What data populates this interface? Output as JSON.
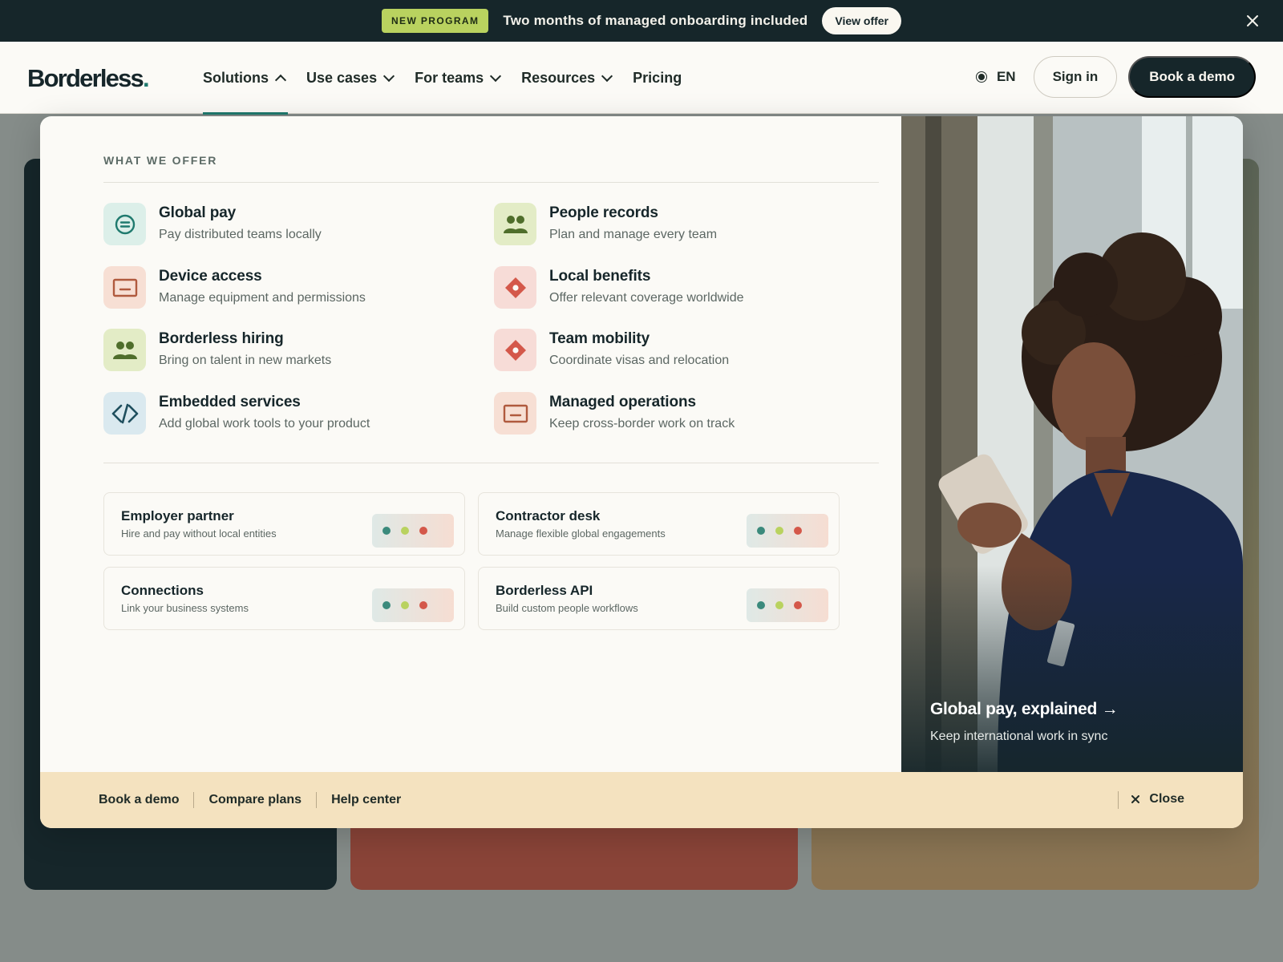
{
  "announcement": {
    "tag": "NEW PROGRAM",
    "message": "Two months of managed onboarding included",
    "cta": "View offer"
  },
  "brand": {
    "name": "Borderless",
    "suffix": "."
  },
  "nav": {
    "items": [
      {
        "label": "Solutions",
        "open": true
      },
      {
        "label": "Use cases"
      },
      {
        "label": "For teams"
      },
      {
        "label": "Resources"
      },
      {
        "label": "Pricing"
      }
    ],
    "lang": "EN",
    "signin": "Sign in",
    "book_demo": "Book a demo"
  },
  "panel": {
    "eyebrow": "WHAT WE OFFER",
    "offers": [
      {
        "title": "Global pay",
        "desc": "Pay distributed teams locally",
        "icon": "global-pay-icon"
      },
      {
        "title": "People records",
        "desc": "Plan and manage every team",
        "icon": "people-icon"
      },
      {
        "title": "Device access",
        "desc": "Manage equipment and permissions",
        "icon": "device-icon"
      },
      {
        "title": "Local benefits",
        "desc": "Offer relevant coverage worldwide",
        "icon": "diamond-icon"
      },
      {
        "title": "Borderless hiring",
        "desc": "Bring on talent in new markets",
        "icon": "people-icon"
      },
      {
        "title": "Team mobility",
        "desc": "Coordinate visas and relocation",
        "icon": "diamond-icon"
      },
      {
        "title": "Embedded services",
        "desc": "Add global work tools to your product",
        "icon": "code-icon"
      },
      {
        "title": "Managed operations",
        "desc": "Keep cross-border work on track",
        "icon": "device-icon"
      }
    ],
    "cards": [
      {
        "title": "Employer partner",
        "desc": "Hire and pay without local entities"
      },
      {
        "title": "Contractor desk",
        "desc": "Manage flexible global engagements"
      },
      {
        "title": "Connections",
        "desc": "Link your business systems"
      },
      {
        "title": "Borderless API",
        "desc": "Build custom people workflows"
      }
    ],
    "feature": {
      "title": "Global pay, explained →",
      "subtitle": "Keep international work in sync"
    },
    "footer": {
      "links": [
        "Book a demo",
        "Compare plans",
        "Help center"
      ],
      "close": "Close"
    }
  },
  "colors": {
    "accent": "#1f7a6e",
    "dark": "#16262a",
    "lime": "#b9d25f",
    "coral": "#d4584a",
    "strip": "#f4e2bf"
  }
}
